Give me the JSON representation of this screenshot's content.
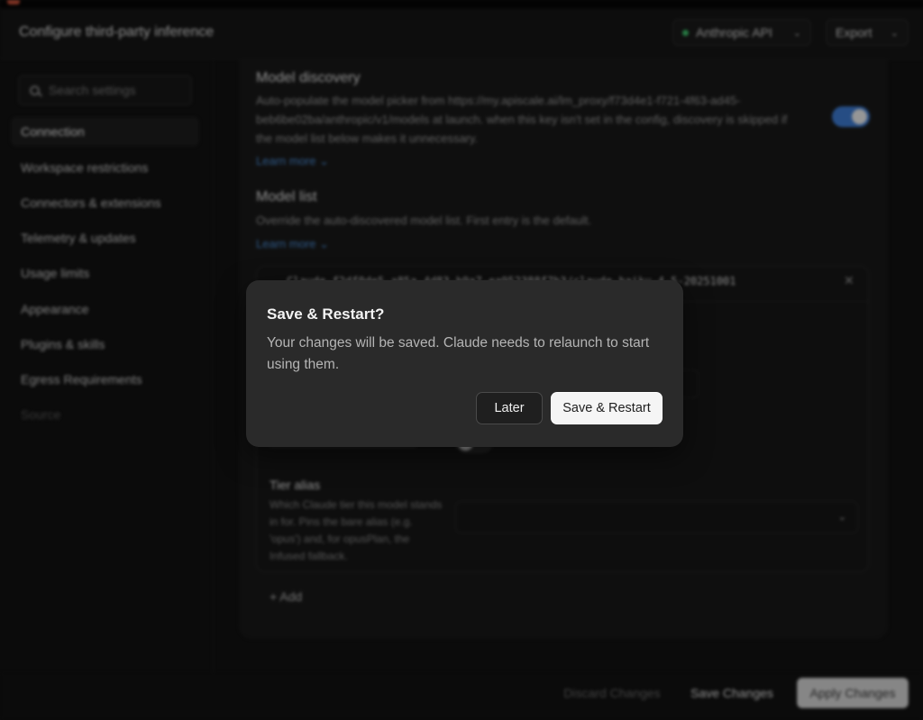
{
  "window": {
    "title": "Configure third-party inference"
  },
  "header": {
    "provider": {
      "label": "Anthropic API",
      "status_color": "#3ec46d"
    },
    "export_label": "Export"
  },
  "sidebar": {
    "search_placeholder": "Search settings",
    "items": [
      {
        "label": "Connection",
        "active": true
      },
      {
        "label": "Workspace restrictions"
      },
      {
        "label": "Connectors & extensions"
      },
      {
        "label": "Telemetry & updates"
      },
      {
        "label": "Usage limits"
      },
      {
        "label": "Appearance"
      },
      {
        "label": "Plugins & skills"
      },
      {
        "label": "Egress Requirements"
      },
      {
        "label": "Source",
        "muted": true
      }
    ]
  },
  "main": {
    "model_discovery": {
      "title": "Model discovery",
      "description": "Auto-populate the model picker from https://my.apiscale.ai/lm_proxy/f73d4e1-f721-4f63-ad45-beb6be02ba/anthropic/v1/models at launch. when this key isn't set in the config, discovery is skipped if the model list below makes it unnecessary.",
      "learn_more": "Learn more",
      "enabled": true
    },
    "model_list": {
      "title": "Model list",
      "description": "Override the auto-discovered model list. First entry is the default.",
      "learn_more": "Learn more",
      "entries": [
        {
          "id": "Claude-f2df0de5-a85a-4d83-b9a7-ea952388f7b3/claude-haiku-4-5-20251001"
        }
      ],
      "tier_alias": {
        "title": "Tier alias",
        "description": "Which Claude tier this model stands in for. Pins the bare alias (e.g. 'opus') and, for opusPlan, the Infused fallback."
      },
      "add_label": "+ Add"
    }
  },
  "footer": {
    "discard_label": "Discard Changes",
    "save_label": "Save Changes",
    "apply_label": "Apply Changes"
  },
  "dialog": {
    "title": "Save & Restart?",
    "body": "Your changes will be saved. Claude needs to relaunch to start using them.",
    "secondary_label": "Later",
    "primary_label": "Save & Restart"
  }
}
